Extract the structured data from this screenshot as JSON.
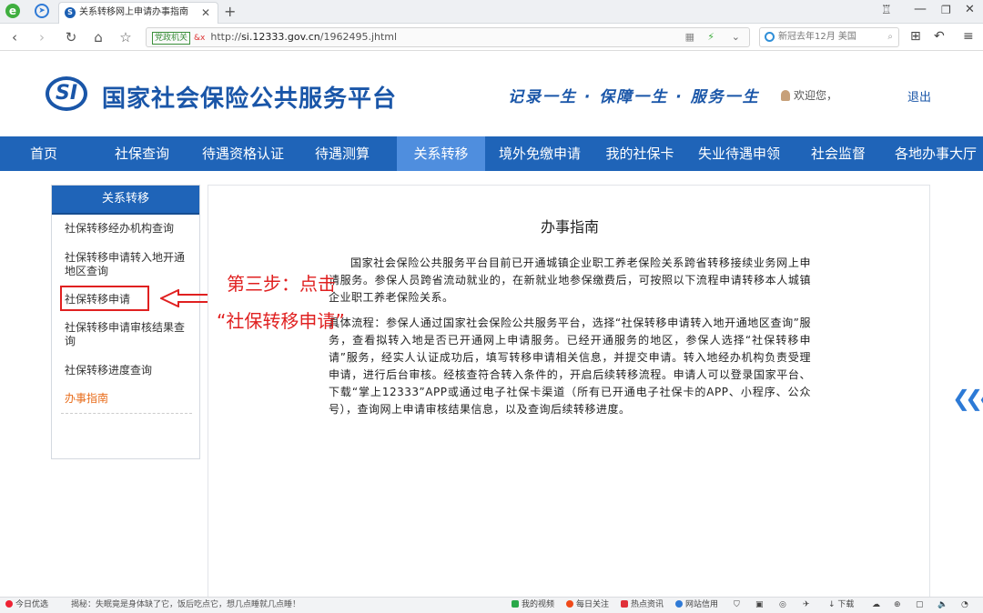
{
  "browser": {
    "tab_title": "关系转移网上申请办事指南",
    "url_badge": "党政机关",
    "url_prefix": "http://",
    "url_host": "si.12333.gov.cn",
    "url_path": "/1962495.jhtml",
    "search_text": "新冠去年12月 美国"
  },
  "header": {
    "logo_text": "SI",
    "site_title": "国家社会保险公共服务平台",
    "slogan": "记录一生 · 保障一生 · 服务一生",
    "welcome": "欢迎您，",
    "logout": "退出"
  },
  "nav": {
    "items": [
      "首页",
      "社保查询",
      "待遇资格认证",
      "待遇测算",
      "关系转移",
      "境外免缴申请",
      "我的社保卡",
      "失业待遇申领",
      "社会监督",
      "各地办事大厅"
    ],
    "active_index": 4
  },
  "sidebar": {
    "heading": "关系转移",
    "items": [
      "社保转移经办机构查询",
      "社保转移申请转入地开通地区查询",
      "社保转移申请",
      "社保转移申请审核结果查询",
      "社保转移进度查询",
      "办事指南"
    ]
  },
  "annotation": {
    "step": "第三步：点击",
    "target": "“社保转移申请”"
  },
  "content": {
    "title": "办事指南",
    "para1": "国家社会保险公共服务平台目前已开通城镇企业职工养老保险关系跨省转移接续业务网上申请服务。参保人员跨省流动就业的，在新就业地参保缴费后，可按照以下流程申请转移本人城镇企业职工养老保险关系。",
    "para2": "具体流程：参保人通过国家社会保险公共服务平台，选择“社保转移申请转入地开通地区查询”服务，查看拟转入地是否已开通网上申请服务。已经开通服务的地区，参保人选择“社保转移申请”服务，经实人认证成功后，填写转移申请相关信息，并提交申请。转入地经办机构负责受理申请，进行后台审核。经核查符合转入条件的，开启后续转移流程。申请人可以登录国家平台、下载“掌上12333”APP或通过电子社保卡渠道（所有已开通电子社保卡的APP、小程序、公众号），查询网上申请审核结果信息，以及查询后续转移进度。"
  },
  "statusbar": {
    "left1": "今日优选",
    "left2": "揭秘：失眠竟是身体缺了它，饭后吃点它，想几点睡就几点睡！",
    "items": [
      "我的视频",
      "每日关注",
      "热点资讯",
      "网站信用",
      "下载"
    ]
  },
  "colors": {
    "brand_blue": "#1f64b8",
    "active_nav": "#4f8ede",
    "annotation_red": "#e02020",
    "sidebar_active": "#e86c1a"
  }
}
